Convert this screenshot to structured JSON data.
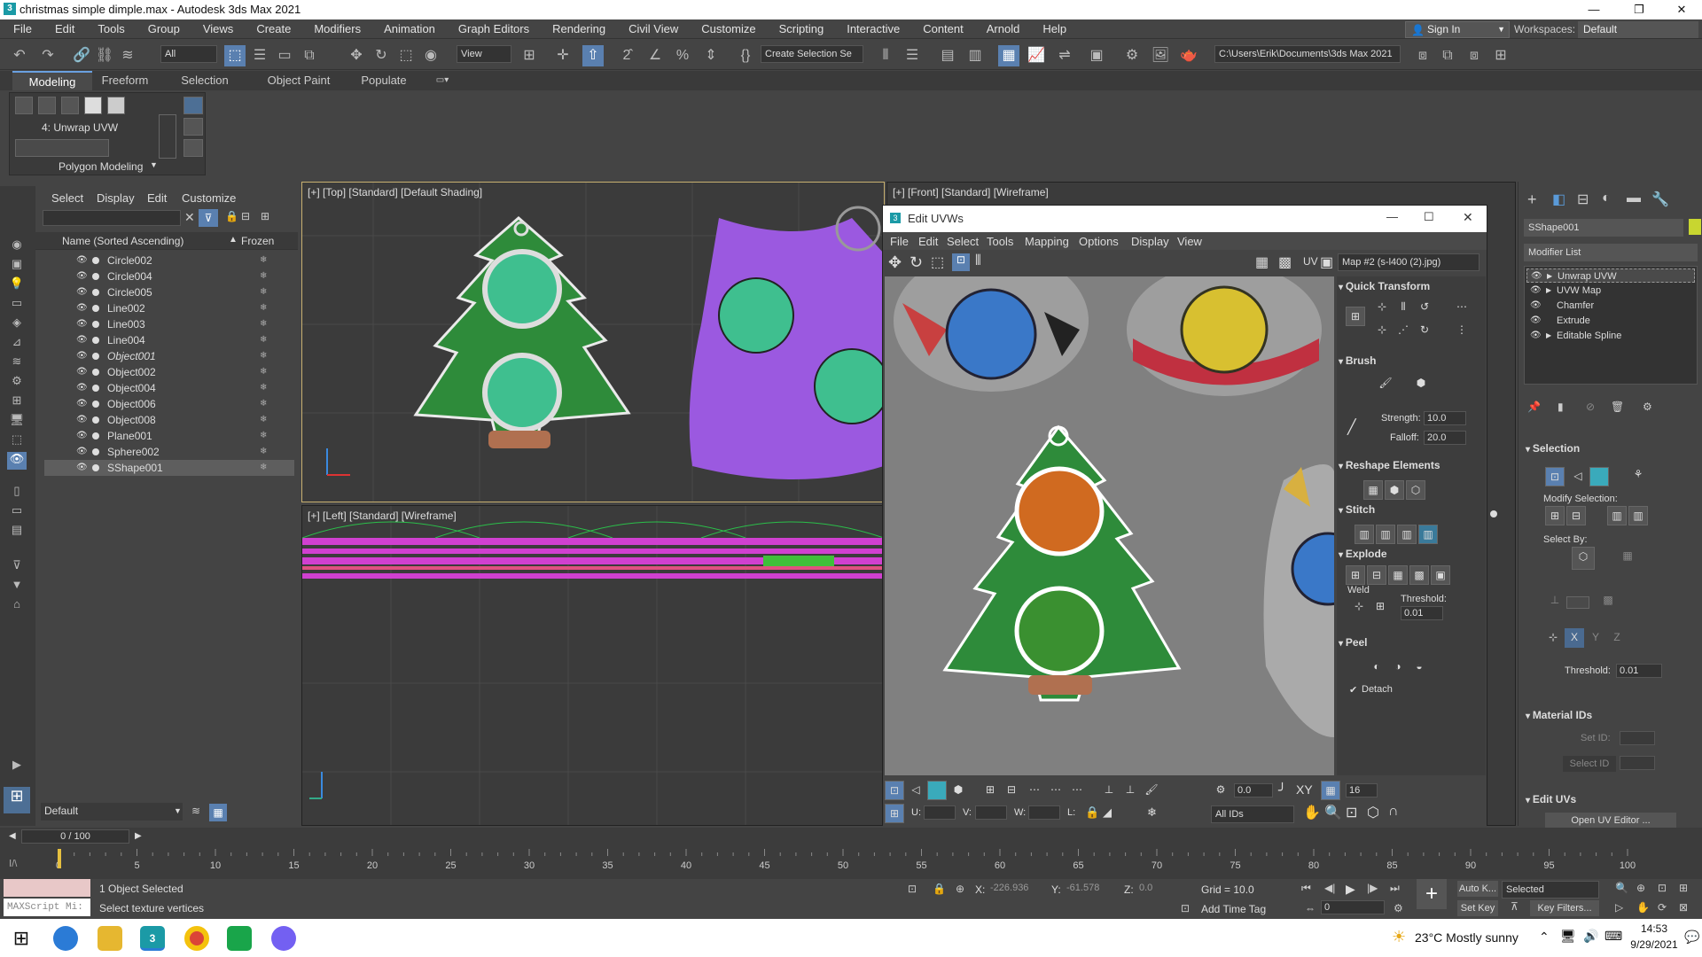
{
  "window": {
    "title": "christmas simple dimple.max - Autodesk 3ds Max 2021",
    "min": "—",
    "max": "❐",
    "close": "✕"
  },
  "menu": [
    "File",
    "Edit",
    "Tools",
    "Group",
    "Views",
    "Create",
    "Modifiers",
    "Animation",
    "Graph Editors",
    "Rendering",
    "Civil View",
    "Customize",
    "Scripting",
    "Interactive",
    "Content",
    "Arnold",
    "Help"
  ],
  "account": {
    "sign_in": "Sign In",
    "workspaces_label": "Workspaces:",
    "workspace": "Default"
  },
  "toolbar": {
    "filter": "All",
    "view": "View",
    "selection_set": "Create Selection Se",
    "project_path": "C:\\Users\\Erik\\Documents\\3ds Max 2021"
  },
  "ribbon": {
    "tabs": [
      "Modeling",
      "Freeform",
      "Selection",
      "Object Paint",
      "Populate"
    ],
    "active_tab": "Modeling",
    "modifier_label": "4: Unwrap UVW",
    "panel_label": "Polygon Modeling"
  },
  "explorer": {
    "menu": [
      "Select",
      "Display",
      "Edit",
      "Customize"
    ],
    "col_name": "Name (Sorted Ascending)",
    "col_frozen": "Frozen",
    "rows": [
      {
        "name": "Circle002",
        "italic": false,
        "selected": false
      },
      {
        "name": "Circle004",
        "italic": false,
        "selected": false
      },
      {
        "name": "Circle005",
        "italic": false,
        "selected": false
      },
      {
        "name": "Line002",
        "italic": false,
        "selected": false
      },
      {
        "name": "Line003",
        "italic": false,
        "selected": false
      },
      {
        "name": "Line004",
        "italic": false,
        "selected": false
      },
      {
        "name": "Object001",
        "italic": true,
        "selected": false
      },
      {
        "name": "Object002",
        "italic": false,
        "selected": false
      },
      {
        "name": "Object004",
        "italic": false,
        "selected": false
      },
      {
        "name": "Object006",
        "italic": false,
        "selected": false
      },
      {
        "name": "Object008",
        "italic": false,
        "selected": false
      },
      {
        "name": "Plane001",
        "italic": false,
        "selected": false
      },
      {
        "name": "Sphere002",
        "italic": false,
        "selected": false
      },
      {
        "name": "SShape001",
        "italic": false,
        "selected": true
      }
    ],
    "layer": "Default"
  },
  "viewports": {
    "top": "[+] [Top] [Standard] [Default Shading]",
    "front": "[+] [Front] [Standard] [Wireframe]",
    "left": "[+] [Left] [Standard] [Wireframe]"
  },
  "uv_editor": {
    "title": "Edit UVWs",
    "menu": [
      "File",
      "Edit",
      "Select",
      "Tools",
      "Mapping",
      "Options",
      "Display",
      "View"
    ],
    "map": "Map #2 (s-l400 (2).jpg)",
    "uv_label": "UV",
    "sections": {
      "quick_transform": "Quick Transform",
      "brush": "Brush",
      "strength_label": "Strength:",
      "strength": "10.0",
      "falloff_label": "Falloff:",
      "falloff": "20.0",
      "reshape": "Reshape Elements",
      "stitch": "Stitch",
      "explode": "Explode",
      "weld": "Weld",
      "threshold_label": "Threshold:",
      "threshold": "0.01",
      "peel": "Peel",
      "detach": "Detach"
    },
    "bottom": {
      "angle": "0.0",
      "xy": "XY",
      "grid": "16",
      "u": "U:",
      "v": "V:",
      "w": "W:",
      "l": "L:",
      "ids": "All IDs"
    }
  },
  "command_panel": {
    "object_name": "SShape001",
    "object_color": "#c8d630",
    "modifier_list": "Modifier List",
    "stack": [
      {
        "name": "Unwrap UVW",
        "selected": true,
        "arrow": true
      },
      {
        "name": "UVW Map",
        "selected": false,
        "arrow": true
      },
      {
        "name": "Chamfer",
        "selected": false,
        "arrow": false
      },
      {
        "name": "Extrude",
        "selected": false,
        "arrow": false
      },
      {
        "name": "Editable Spline",
        "selected": false,
        "arrow": true
      }
    ],
    "selection": "Selection",
    "modify_selection": "Modify Selection:",
    "select_by": "Select By:",
    "threshold_label": "Threshold:",
    "threshold": "0.01",
    "material_ids": "Material IDs",
    "set_id": "Set ID:",
    "select_id": "Select ID",
    "edit_uvs": "Edit UVs",
    "open_uv_editor": "Open UV Editor ..."
  },
  "timeline": {
    "frame": "0 / 100",
    "ticks": [
      "0",
      "5",
      "10",
      "15",
      "20",
      "25",
      "30",
      "35",
      "40",
      "45",
      "50",
      "55",
      "60",
      "65",
      "70",
      "75",
      "80",
      "85",
      "90",
      "95",
      "100"
    ]
  },
  "status": {
    "maxscript": "MAXScript Mi:",
    "selected": "1 Object Selected",
    "prompt": "Select texture vertices",
    "x_label": "X:",
    "x": "-226.936",
    "y_label": "Y:",
    "y": "-61.578",
    "z_label": "Z:",
    "z": "0.0",
    "grid": "Grid = 10.0",
    "add_time_tag": "Add Time Tag",
    "auto_key": "Auto K...",
    "set_key": "Set Key",
    "selected_mode": "Selected",
    "key_filters": "Key Filters...",
    "frame": "0"
  },
  "taskbar": {
    "weather": "23°C  Mostly sunny",
    "time": "14:53",
    "date": "9/29/2021"
  },
  "colors": {
    "accent": "#5a80b0",
    "selection_row": "#5e5e5e",
    "tree_green": "#2e8b3a",
    "bubble_teal": "#3fbf8f",
    "purple": "#9b59e0"
  }
}
